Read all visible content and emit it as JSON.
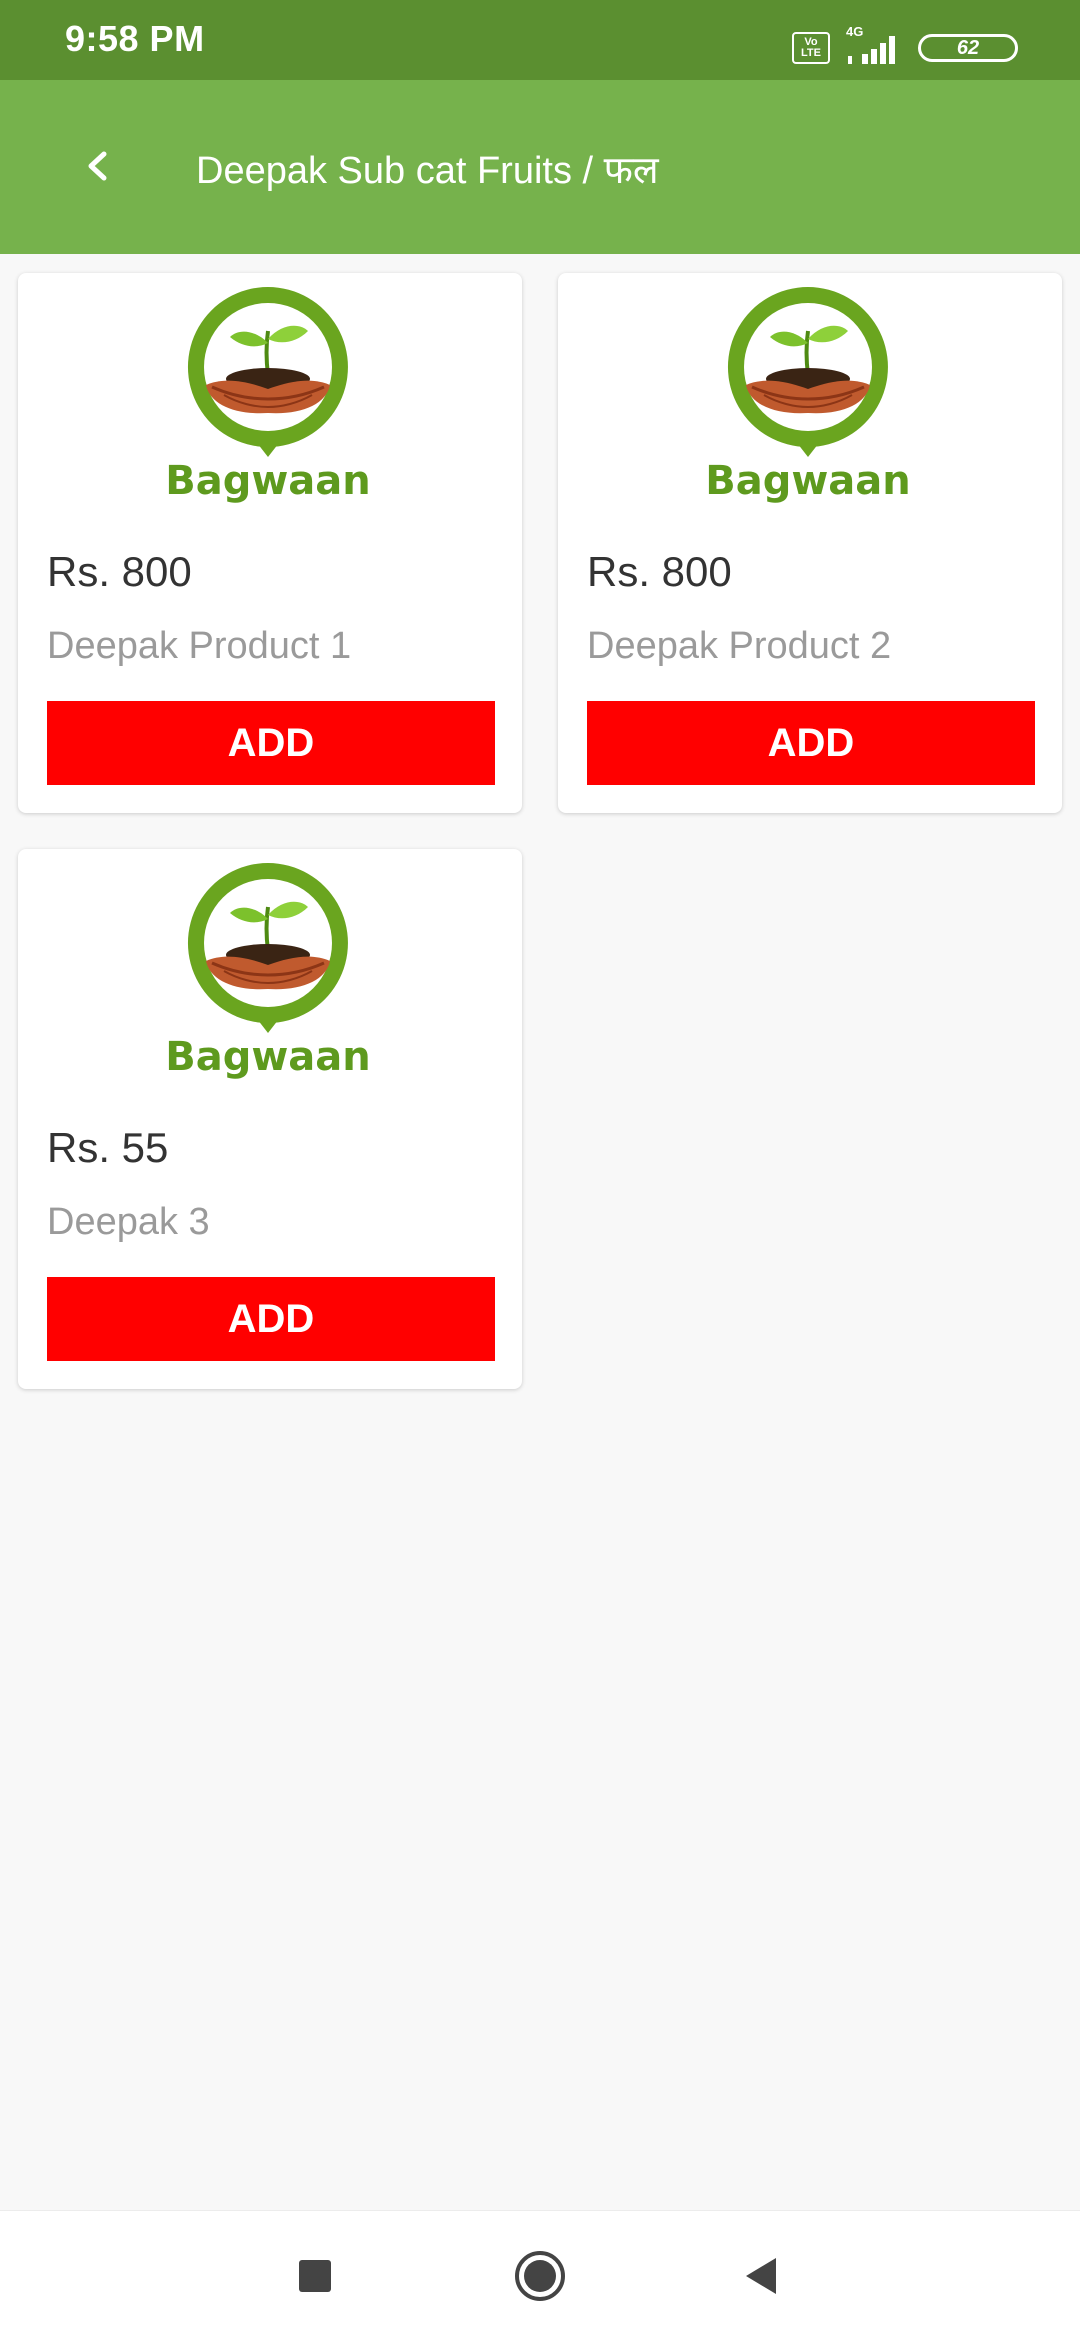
{
  "status_bar": {
    "time": "9:58 PM",
    "volte_top": "Vo",
    "volte_bottom": "LTE",
    "network": "4G",
    "battery": "62"
  },
  "app_bar": {
    "title": "Deepak Sub cat Fruits / फल"
  },
  "products": [
    {
      "price": "Rs. 800",
      "name": "Deepak Product 1",
      "button": "ADD",
      "logo_text": "Bagwaan"
    },
    {
      "price": "Rs. 800",
      "name": "Deepak Product 2",
      "button": "ADD",
      "logo_text": "Bagwaan"
    },
    {
      "price": "Rs. 55",
      "name": "Deepak 3",
      "button": "ADD",
      "logo_text": "Bagwaan"
    }
  ],
  "colors": {
    "status_bar": "#5b8f30",
    "app_bar": "#76b24c",
    "add_button": "#ff0000",
    "logo_green": "#5e9a1e"
  },
  "icons": {
    "back": "back-chevron-icon",
    "nav_recents": "square-icon",
    "nav_home": "circle-icon",
    "nav_back": "triangle-icon"
  }
}
